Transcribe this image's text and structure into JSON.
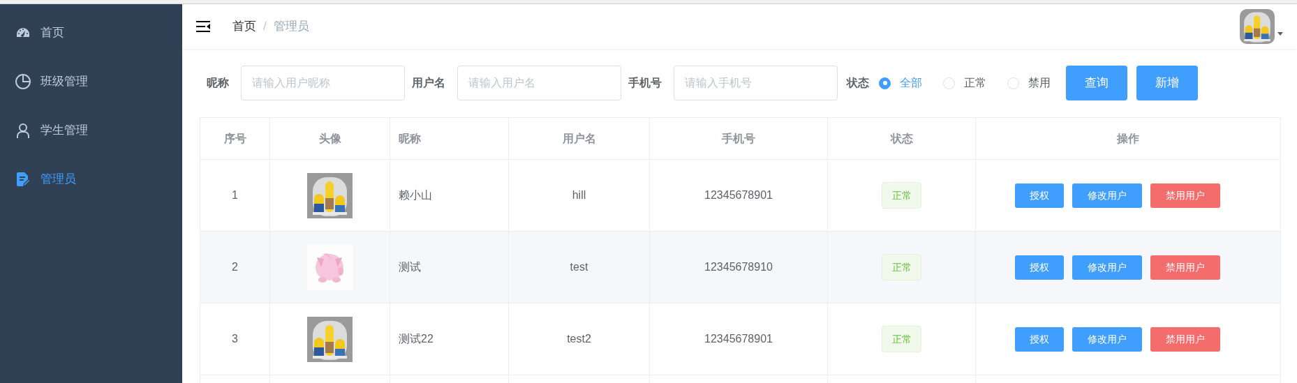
{
  "sidebar": {
    "items": [
      {
        "label": "首页",
        "selected": false
      },
      {
        "label": "班级管理",
        "selected": false
      },
      {
        "label": "学生管理",
        "selected": false
      },
      {
        "label": "管理员",
        "selected": true
      }
    ]
  },
  "breadcrumb": {
    "separator": "/",
    "items": [
      {
        "label": "首页",
        "current": false
      },
      {
        "label": "管理员",
        "current": true
      }
    ]
  },
  "header": {
    "avatar": {
      "kind": "picture"
    }
  },
  "filters": {
    "fields": [
      {
        "label": "昵称",
        "placeholder": "请输入用户昵称"
      },
      {
        "label": "用户名",
        "placeholder": "请输入用户名"
      },
      {
        "label": "手机号",
        "placeholder": "请输入手机号"
      }
    ],
    "status": {
      "label": "状态",
      "options": [
        {
          "label": "全部",
          "selected": true
        },
        {
          "label": "正常",
          "selected": false
        },
        {
          "label": "禁用",
          "selected": false
        }
      ]
    },
    "buttons": [
      "查询",
      "新增"
    ]
  },
  "table": {
    "columns": [
      "序号",
      "头像",
      "昵称",
      "用户名",
      "手机号",
      "状态",
      "操作"
    ],
    "rows": [
      {
        "index": "1",
        "avatar": {
          "kind": "picture"
        },
        "nickname": "赖小山",
        "username": "hill",
        "phone": "12345678901",
        "status": "正常",
        "actions": [
          {
            "label": "授权",
            "color": "#409eff"
          },
          {
            "label": "修改用户",
            "color": "#409eff"
          },
          {
            "label": "禁用用户",
            "color": "#f56c6c"
          }
        ]
      },
      {
        "index": "2",
        "avatar": {
          "kind": "picture"
        },
        "nickname": "测试",
        "username": "test",
        "phone": "12345678910",
        "status": "正常",
        "actions": [
          {
            "label": "授权",
            "color": "#409eff"
          },
          {
            "label": "修改用户",
            "color": "#409eff"
          },
          {
            "label": "禁用用户",
            "color": "#f56c6c"
          }
        ]
      },
      {
        "index": "3",
        "avatar": {
          "kind": "picture"
        },
        "nickname": "测试22",
        "username": "test2",
        "phone": "12345678901",
        "status": "正常",
        "actions": [
          {
            "label": "授权",
            "color": "#409eff"
          },
          {
            "label": "修改用户",
            "color": "#409eff"
          },
          {
            "label": "禁用用户",
            "color": "#f56c6c"
          }
        ]
      }
    ]
  }
}
